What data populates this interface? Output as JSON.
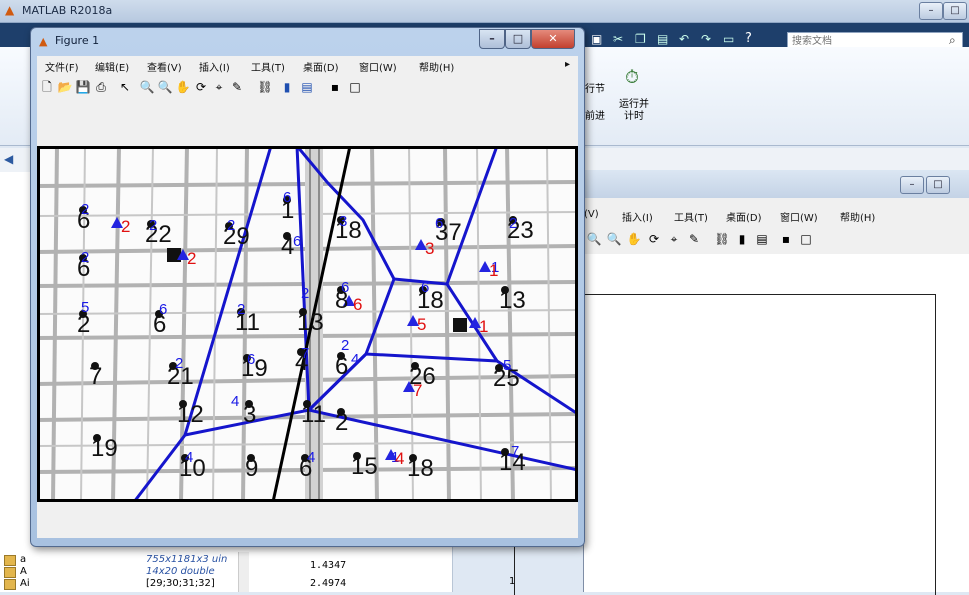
{
  "app": {
    "title": "MATLAB R2018a"
  },
  "search": {
    "placeholder": "搜索文档"
  },
  "ribbon": {
    "run_section": "行节",
    "advance": "前进",
    "run_time": "运行并\n计时"
  },
  "figure1": {
    "title": "Figure 1",
    "menu": [
      "文件(F)",
      "编辑(E)",
      "查看(V)",
      "插入(I)",
      "工具(T)",
      "桌面(D)",
      "窗口(W)",
      "帮助(H)"
    ],
    "plot": {
      "black_labels": [
        {
          "t": "6"
        },
        {
          "t": "22"
        },
        {
          "t": "29"
        },
        {
          "t": "1"
        },
        {
          "t": "18"
        },
        {
          "t": "37"
        },
        {
          "t": "23"
        },
        {
          "t": "6"
        },
        {
          "t": "4"
        },
        {
          "t": "2"
        },
        {
          "t": "6"
        },
        {
          "t": "11"
        },
        {
          "t": "13"
        },
        {
          "t": "8"
        },
        {
          "t": "18"
        },
        {
          "t": "13"
        },
        {
          "t": "7"
        },
        {
          "t": "21"
        },
        {
          "t": "19"
        },
        {
          "t": "4"
        },
        {
          "t": "6"
        },
        {
          "t": "26"
        },
        {
          "t": "25"
        },
        {
          "t": "12"
        },
        {
          "t": "3"
        },
        {
          "t": "11"
        },
        {
          "t": "2"
        },
        {
          "t": "19"
        },
        {
          "t": "10"
        },
        {
          "t": "9"
        },
        {
          "t": "6"
        },
        {
          "t": "15"
        },
        {
          "t": "18"
        },
        {
          "t": "14"
        }
      ],
      "red_labels": [
        {
          "t": "2"
        },
        {
          "t": "2"
        },
        {
          "t": "3"
        },
        {
          "t": "6"
        },
        {
          "t": "1"
        },
        {
          "t": "5"
        },
        {
          "t": "1"
        },
        {
          "t": "7"
        },
        {
          "t": "4"
        }
      ],
      "blue_labels": [
        {
          "t": "2"
        },
        {
          "t": "2"
        },
        {
          "t": "2"
        },
        {
          "t": "6"
        },
        {
          "t": "3"
        },
        {
          "t": "6"
        },
        {
          "t": "2"
        },
        {
          "t": "2"
        },
        {
          "t": "6"
        },
        {
          "t": "5"
        },
        {
          "t": "6"
        },
        {
          "t": "2"
        },
        {
          "t": "2"
        },
        {
          "t": "6"
        },
        {
          "t": "6"
        },
        {
          "t": "2"
        },
        {
          "t": "6"
        },
        {
          "t": "7"
        },
        {
          "t": "2"
        },
        {
          "t": "4"
        },
        {
          "t": "4"
        },
        {
          "t": "4"
        },
        {
          "t": "4"
        },
        {
          "t": "7"
        },
        {
          "t": "5"
        },
        {
          "t": "1"
        },
        {
          "t": "1"
        }
      ]
    }
  },
  "figure2": {
    "menu": [
      "(V)",
      "插入(I)",
      "工具(T)",
      "桌面(D)",
      "窗口(W)",
      "帮助(H)"
    ],
    "tick_label": "1"
  },
  "workspace": {
    "rows": [
      {
        "name": "a",
        "value": "755x1181x3 uin"
      },
      {
        "name": "A",
        "value": "14x20 double"
      },
      {
        "name": "Ai",
        "value": "[29;30;31;32]"
      }
    ]
  },
  "command": {
    "values": [
      "1.4347",
      "2.4974"
    ]
  },
  "colors": {
    "accent": "#1e3f6b",
    "plot_blue": "#0000dd",
    "plot_red": "#e01010"
  }
}
